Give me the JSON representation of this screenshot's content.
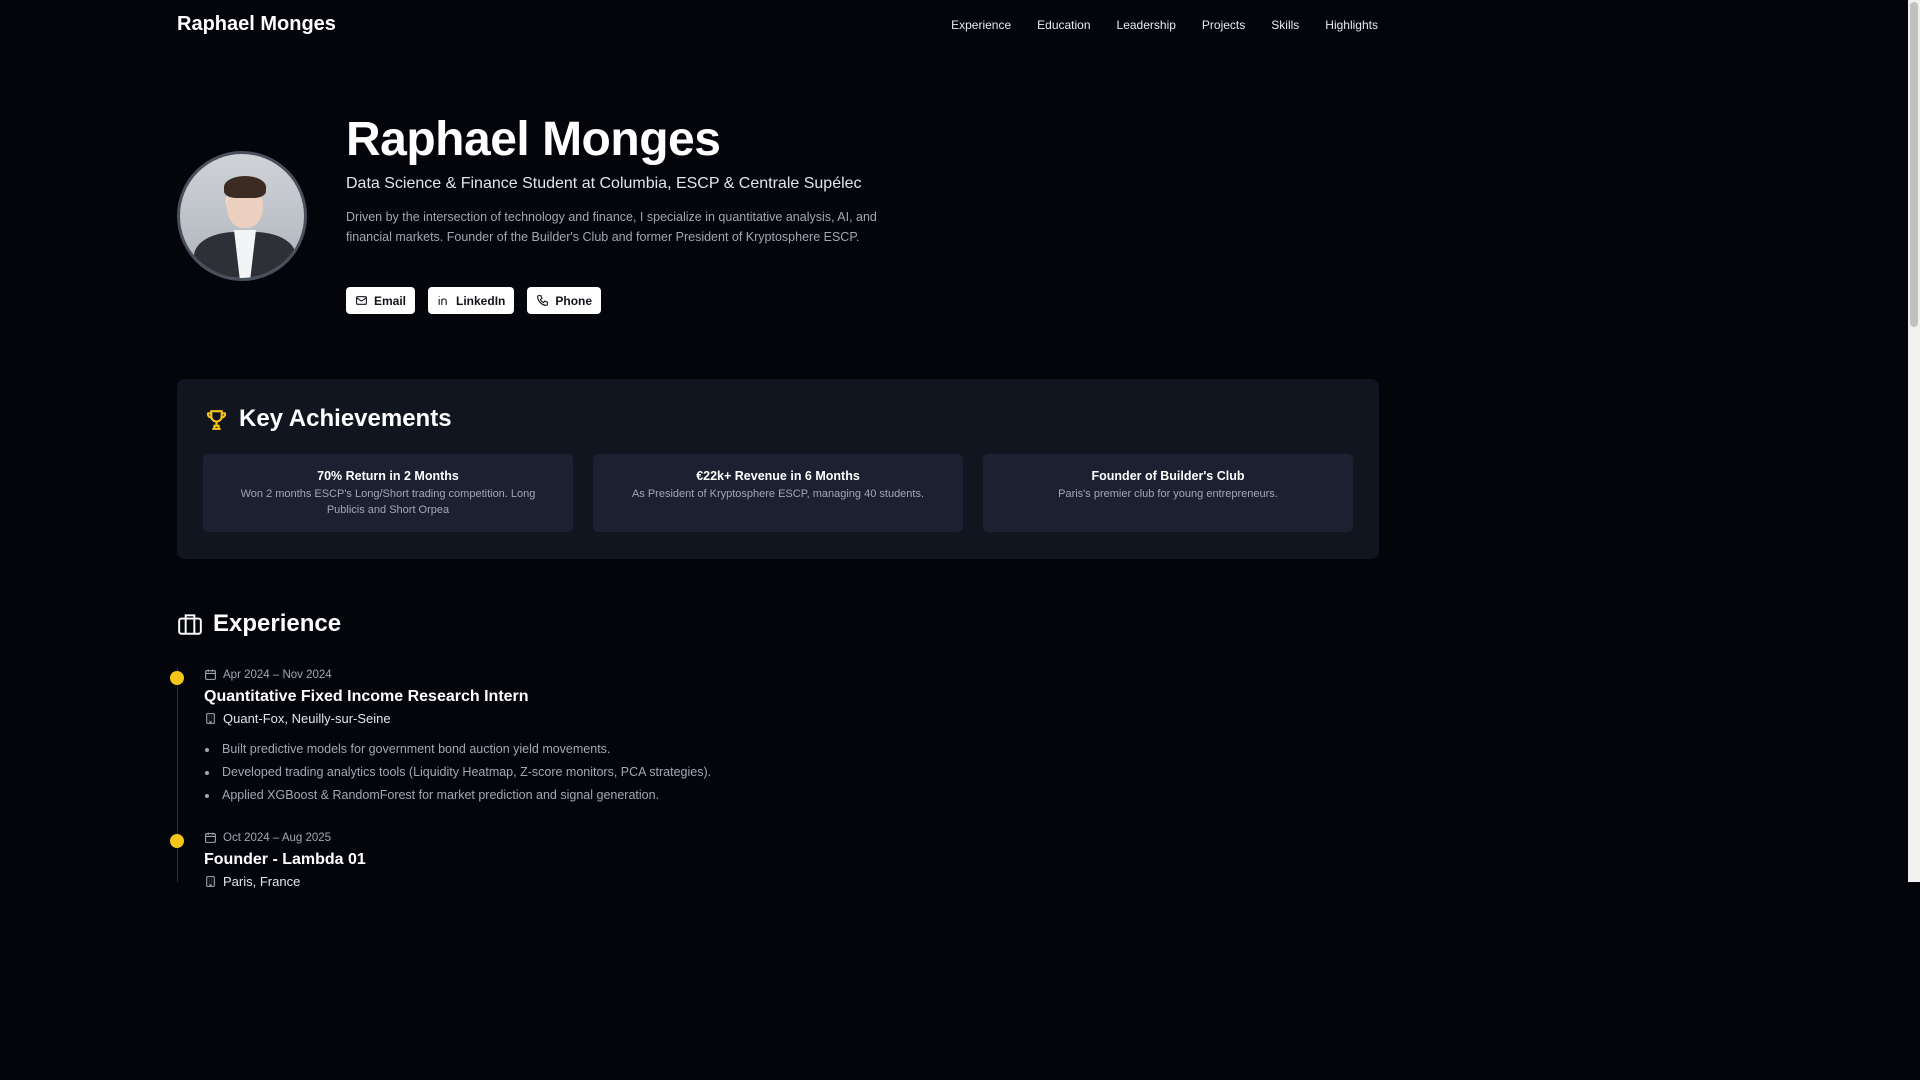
{
  "nav": {
    "brand": "Raphael Monges",
    "links": [
      "Experience",
      "Education",
      "Leadership",
      "Projects",
      "Skills",
      "Highlights"
    ]
  },
  "hero": {
    "name": "Raphael Monges",
    "subtitle": "Data Science & Finance Student at Columbia, ESCP & Centrale Supélec",
    "description": "Driven by the intersection of technology and finance, I specialize in quantitative analysis, AI, and financial markets. Founder of the Builder's Club and former President of Kryptosphere ESCP.",
    "buttons": [
      {
        "label": "Email",
        "icon": "mail-icon"
      },
      {
        "label": "LinkedIn",
        "icon": "linkedin-icon"
      },
      {
        "label": "Phone",
        "icon": "phone-icon"
      }
    ]
  },
  "achievements": {
    "title": "Key Achievements",
    "icon": "trophy-icon",
    "items": [
      {
        "title": "70% Return in 2 Months",
        "text": "Won 2 months ESCP's Long/Short trading competition. Long Publicis and Short Orpea"
      },
      {
        "title": "€22k+ Revenue in 6 Months",
        "text": "As President of Kryptosphere ESCP, managing 40 students."
      },
      {
        "title": "Founder of Builder's Club",
        "text": "Paris's premier club for young entrepreneurs."
      }
    ]
  },
  "experience": {
    "title": "Experience",
    "icon": "briefcase-icon",
    "accent": "#f5c518",
    "items": [
      {
        "date": "Apr 2024 – Nov 2024",
        "role": "Quantitative Fixed Income Research Intern",
        "org": "Quant-Fox, Neuilly-sur-Seine",
        "bullets": [
          "Built predictive models for government bond auction yield movements.",
          "Developed trading analytics tools (Liquidity Heatmap, Z-score monitors, PCA strategies).",
          "Applied XGBoost & RandomForest for market prediction and signal generation."
        ]
      },
      {
        "date": "Oct 2024 – Aug 2025",
        "role": "Founder - Lambda 01",
        "org": "Paris, France",
        "bullets": []
      }
    ]
  }
}
